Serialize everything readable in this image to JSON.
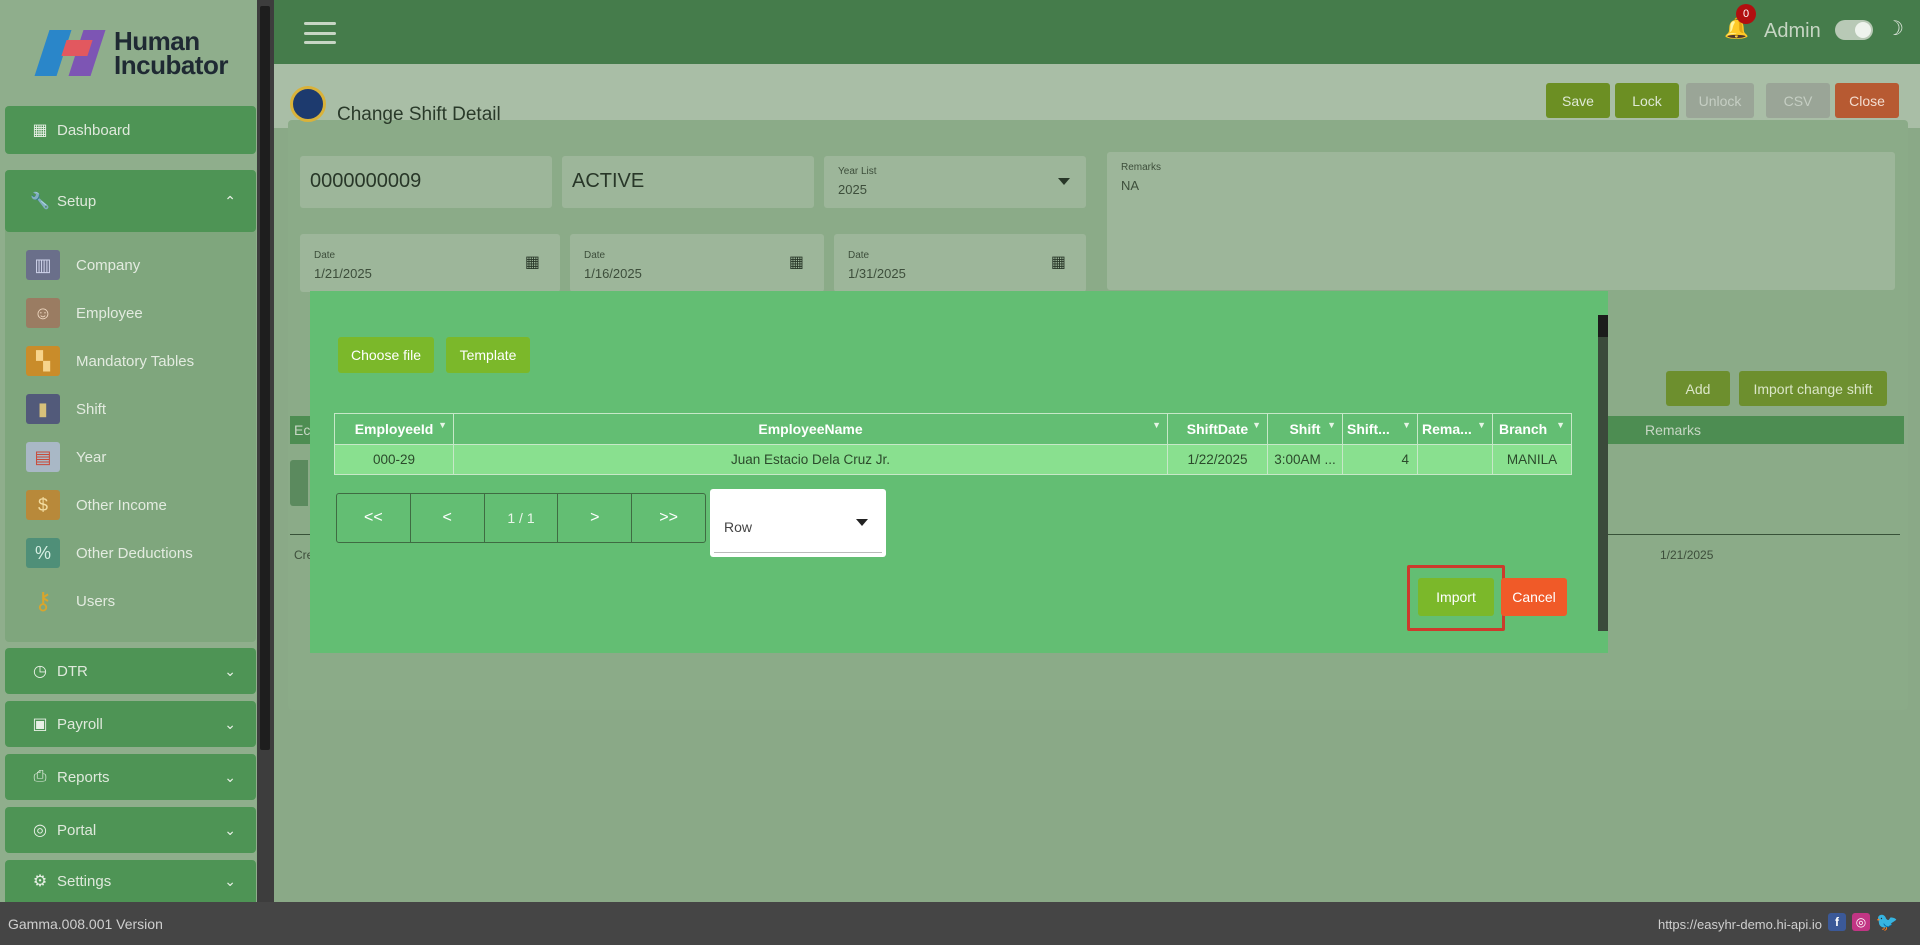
{
  "app": {
    "brand_line1": "Human",
    "brand_line2": "Incubator"
  },
  "sidebar": {
    "dashboard": "Dashboard",
    "setup": "Setup",
    "setup_items": [
      {
        "label": "Company",
        "icon": "building-icon"
      },
      {
        "label": "Employee",
        "icon": "employee-icon"
      },
      {
        "label": "Mandatory Tables",
        "icon": "grid-icon"
      },
      {
        "label": "Shift",
        "icon": "shift-icon"
      },
      {
        "label": "Year",
        "icon": "calendar-icon"
      },
      {
        "label": "Other Income",
        "icon": "money-bag-icon"
      },
      {
        "label": "Other Deductions",
        "icon": "deduction-icon"
      },
      {
        "label": "Users",
        "icon": "key-icon"
      }
    ],
    "dtr": "DTR",
    "payroll": "Payroll",
    "reports": "Reports",
    "portal": "Portal",
    "settings": "Settings"
  },
  "header": {
    "notification_count": "0",
    "user": "Admin"
  },
  "page": {
    "title": "Change Shift Detail",
    "toolbar": {
      "save": "Save",
      "lock": "Lock",
      "unlock": "Unlock",
      "csv": "CSV",
      "close": "Close"
    },
    "form": {
      "doc_number": "0000000009",
      "status": "ACTIVE",
      "year_label": "Year List",
      "year_value": "2025",
      "remarks_label": "Remarks",
      "remarks_value": "NA",
      "date_label": "Date",
      "date1": "1/21/2025",
      "date2": "1/16/2025",
      "date3": "1/31/2025"
    },
    "add_button": "Add",
    "import_change_shift": "Import change shift",
    "grid_remarks_header": "Remarks",
    "bg_row_date": "1/21/2025",
    "bg_col_fragment": "Ec",
    "bg_cr_fragment": "Cre"
  },
  "modal": {
    "choose_file": "Choose file",
    "template": "Template",
    "columns": [
      "EmployeeId",
      "EmployeeName",
      "ShiftDate",
      "Shift",
      "Shift...",
      "Rema...",
      "Branch"
    ],
    "rows": [
      [
        "000-29",
        "Juan Estacio Dela Cruz Jr.",
        "1/22/2025",
        "3:00AM ...",
        "4",
        "",
        "MANILA"
      ]
    ],
    "pager": {
      "first": "<<",
      "prev": "<",
      "info": "1 / 1",
      "next": ">",
      "last": ">>"
    },
    "row_select": "Row",
    "import": "Import",
    "cancel": "Cancel"
  },
  "footer": {
    "version": "Gamma.008.001 Version",
    "url": "https://easyhr-demo.hi-api.io"
  },
  "colors": {
    "header_green": "#457c4b",
    "modal_green": "#63be73",
    "button_lime": "#7bb82a",
    "cancel_orange": "#f05a28",
    "close_red": "#e0522c"
  }
}
